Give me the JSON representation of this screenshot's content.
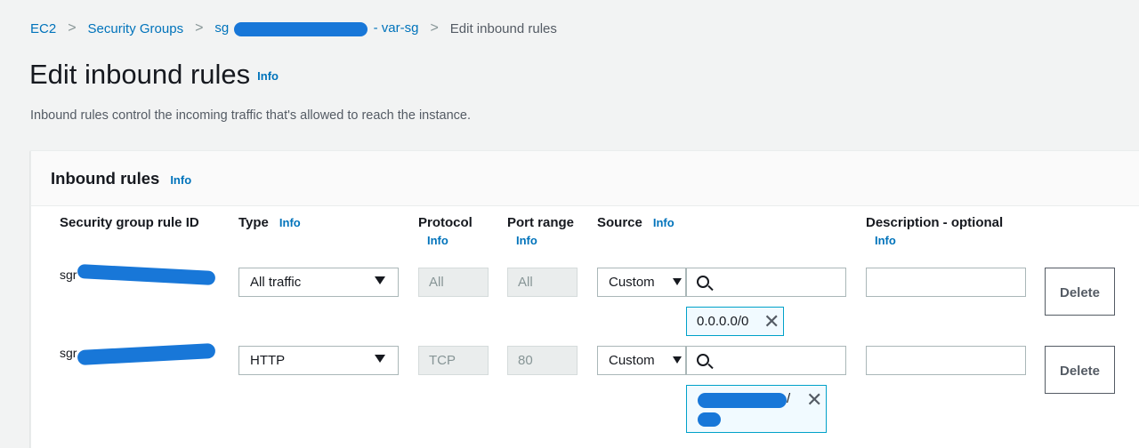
{
  "breadcrumb": {
    "items": [
      "EC2",
      "Security Groups",
      "sg",
      "- var-sg",
      "Edit inbound rules"
    ],
    "separator": ">"
  },
  "page": {
    "title": "Edit inbound rules",
    "title_info": "Info",
    "description": "Inbound rules control the incoming traffic that's allowed to reach the instance."
  },
  "panel": {
    "title": "Inbound rules",
    "info": "Info",
    "columns": {
      "rule_id": "Security group rule ID",
      "type": "Type",
      "protocol": "Protocol",
      "port_range": "Port range",
      "source": "Source",
      "description": "Description - optional",
      "info": "Info"
    }
  },
  "rules": [
    {
      "rule_id": "sgr",
      "type": "All traffic",
      "protocol": "All",
      "port_range": "All",
      "source_type": "Custom",
      "source_token": "0.0.0.0/0",
      "description": "",
      "delete_label": "Delete"
    },
    {
      "rule_id": "sgr",
      "type": "HTTP",
      "protocol": "TCP",
      "port_range": "80",
      "source_type": "Custom",
      "source_token": "/",
      "description": "",
      "delete_label": "Delete"
    }
  ],
  "icons": {
    "close": "✕",
    "separator": "chevron-right-icon",
    "search": "search-icon",
    "dropdown": "caret-down-icon"
  },
  "colors": {
    "link": "#0073bb",
    "token_border": "#00a1c9",
    "redaction": "#1877d8"
  }
}
